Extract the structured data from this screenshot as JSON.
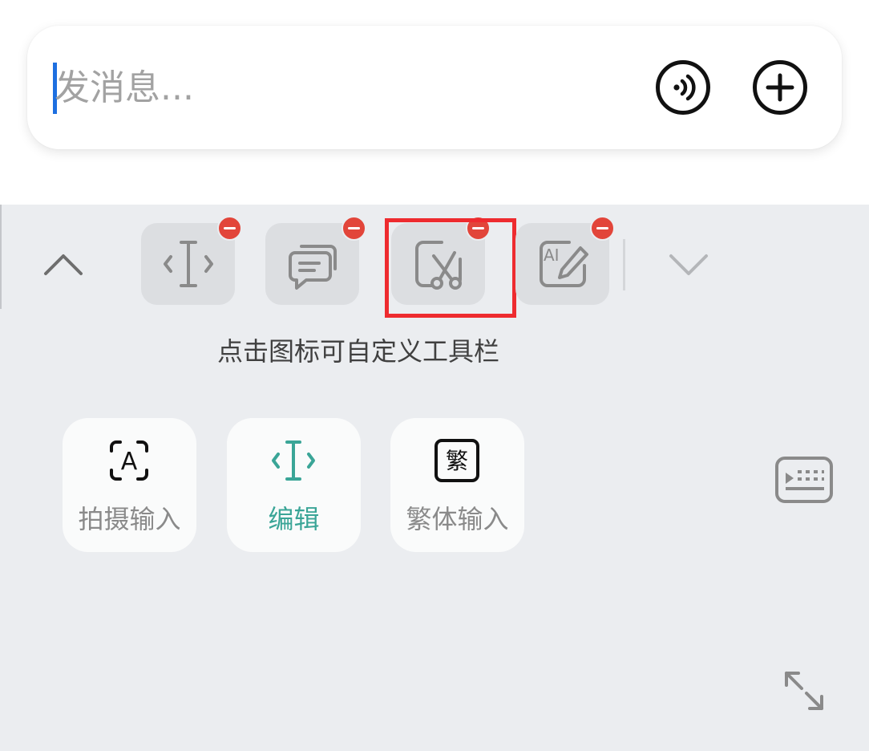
{
  "message_bar": {
    "placeholder": "发消息...",
    "voice_button_icon": "voice-wave-icon",
    "add_button_icon": "plus-circle-icon"
  },
  "toolbar": {
    "collapse_icon": "chevron-up-icon",
    "expand_icon": "chevron-down-icon",
    "items": [
      {
        "icon": "text-cursor-icon",
        "removable": true
      },
      {
        "icon": "chat-bubbles-icon",
        "removable": true
      },
      {
        "icon": "scissors-clip-icon",
        "removable": true,
        "highlighted": true
      },
      {
        "icon": "ai-write-icon",
        "removable": true
      }
    ],
    "hint": "点击图标可自定义工具栏"
  },
  "tools": [
    {
      "label": "拍摄输入",
      "icon": "scan-text-icon",
      "active": false
    },
    {
      "label": "编辑",
      "icon": "text-cursor-icon",
      "active": true
    },
    {
      "label": "繁体输入",
      "icon": "traditional-chinese-icon",
      "active": false
    }
  ],
  "colors": {
    "accent": "#3aa597",
    "highlight_border": "#ee2b2f",
    "remove_badge": "#e2453a",
    "caret": "#1d6fe0"
  },
  "keyboard_button_icon": "keyboard-icon",
  "resize_button_icon": "expand-arrows-icon"
}
